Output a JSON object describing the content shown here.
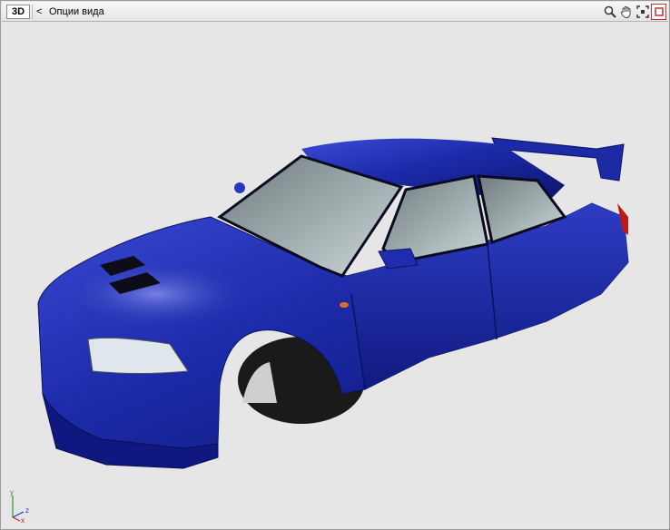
{
  "toolbar": {
    "mode_label": "3D",
    "back_label": "<",
    "title": "Опции вида",
    "icons": [
      "zoom-icon",
      "pan-hand-icon",
      "fit-view-icon",
      "maximize-icon"
    ]
  },
  "viewport": {
    "subject": "blue-sedan-body-model",
    "background_color": "#e6e6e6",
    "car_color": "#1c2aa8"
  },
  "axis": {
    "y_label": "y",
    "z_label": "z",
    "x_label": "x"
  }
}
